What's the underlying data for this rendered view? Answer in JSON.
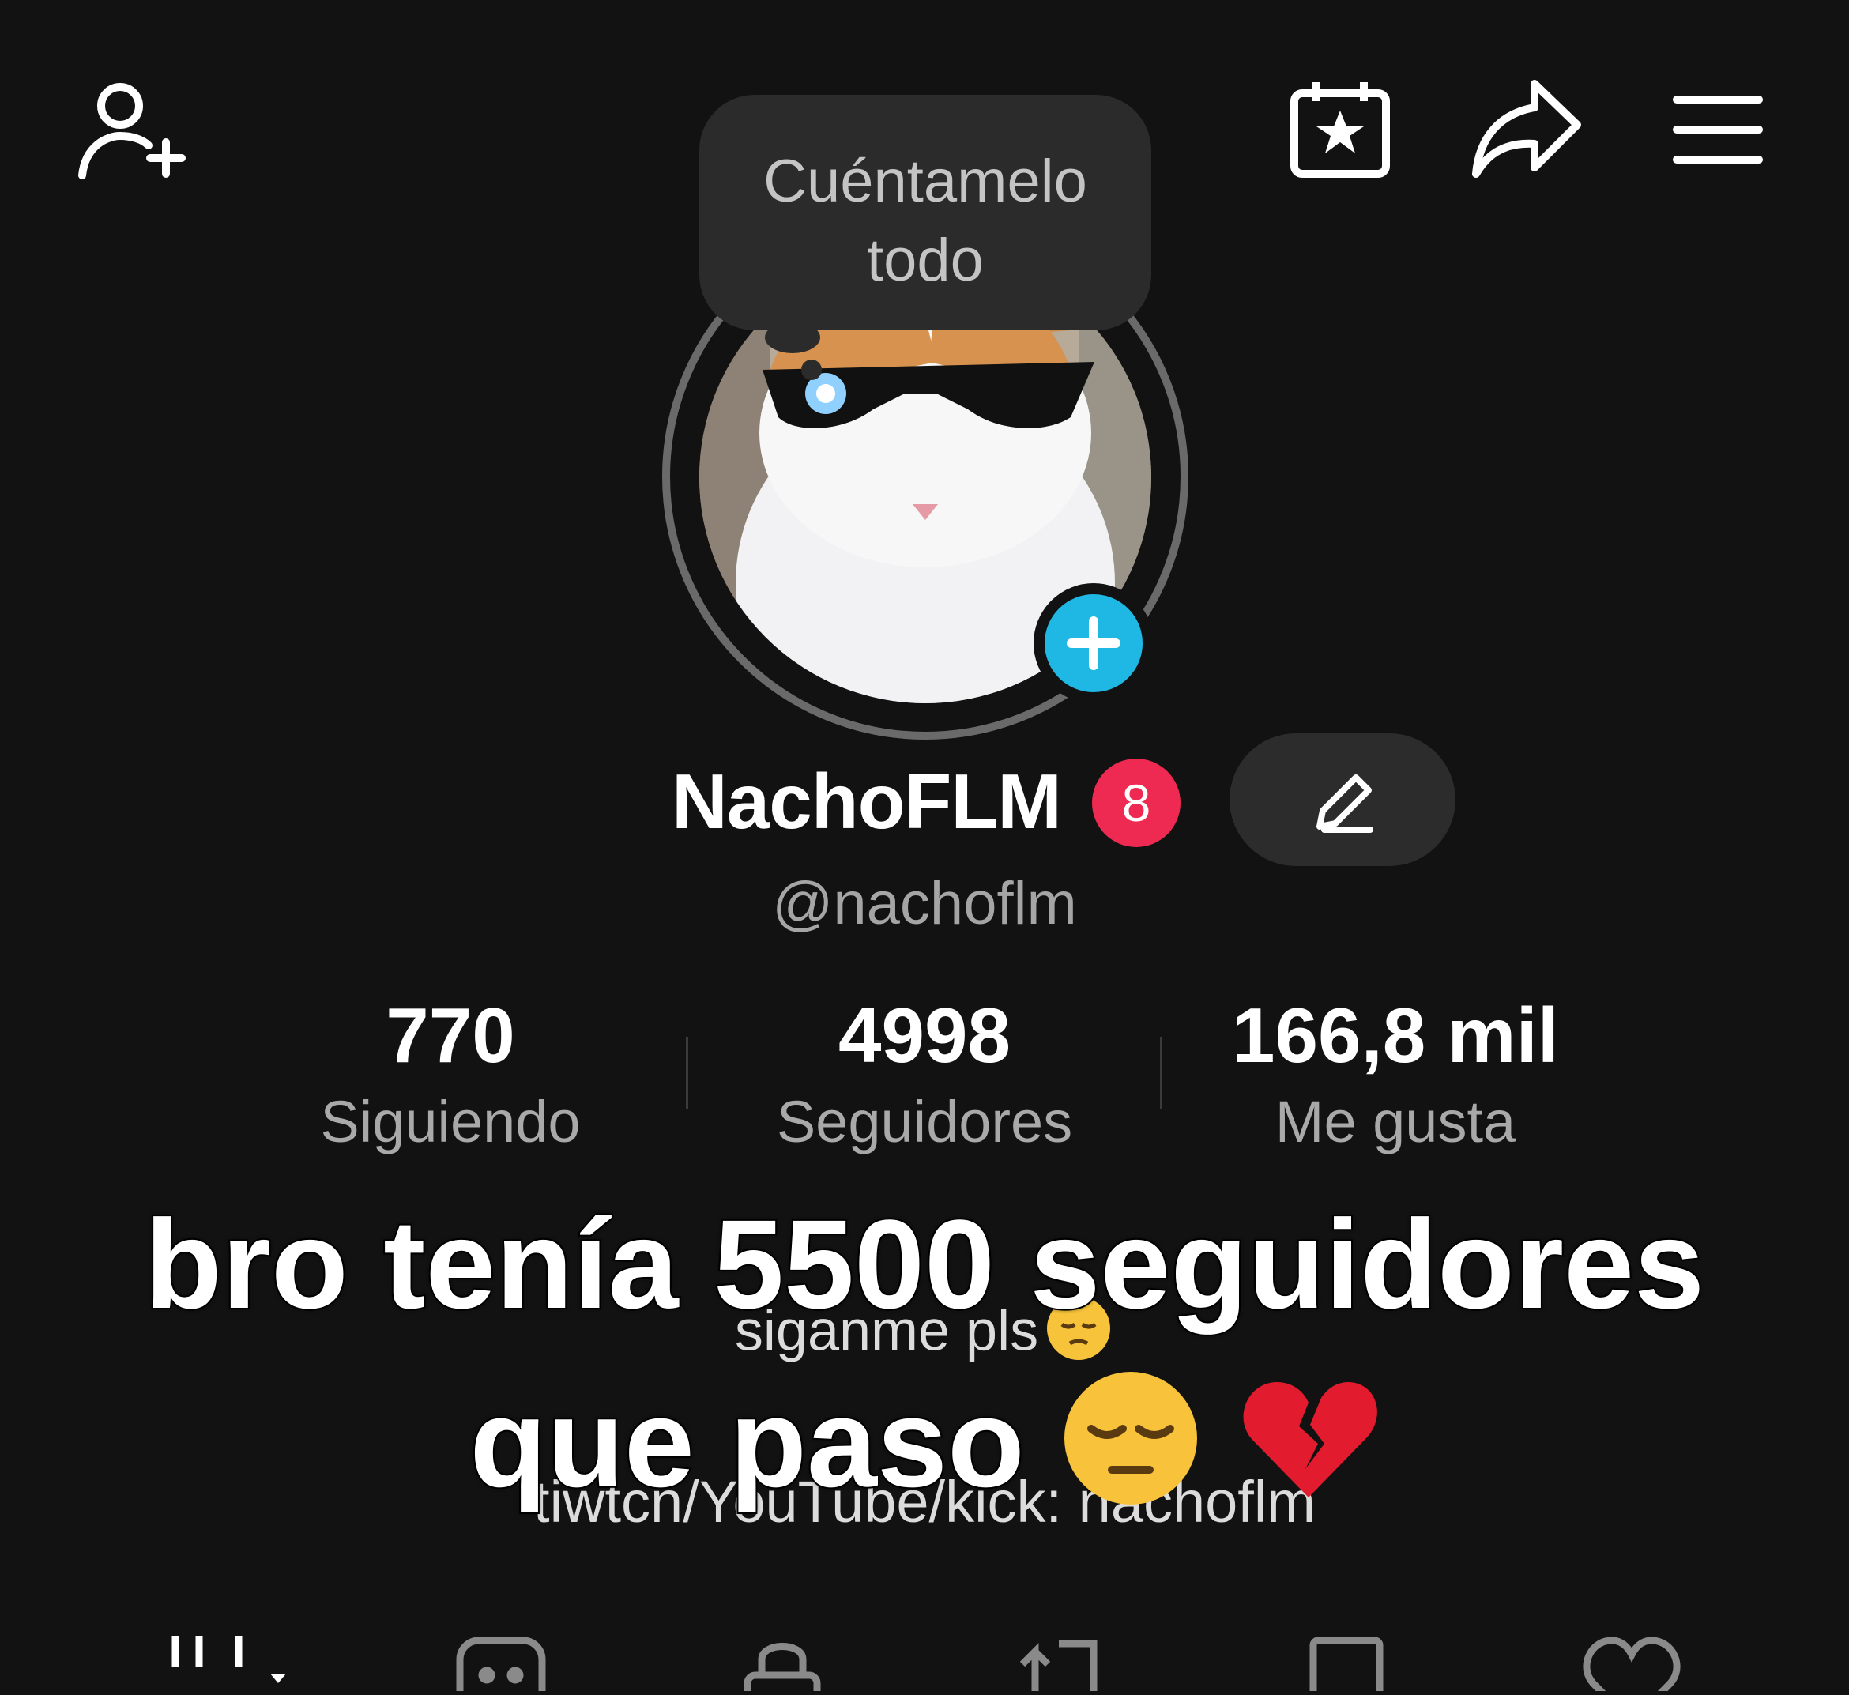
{
  "header": {
    "icons": [
      "add-friend-icon",
      "calendar-star-icon",
      "share-icon",
      "menu-icon"
    ]
  },
  "note": {
    "line1": "Cuéntamelo",
    "line2": "todo"
  },
  "profile": {
    "display_name": "NachoFLM",
    "badge_count": "8",
    "handle": "@nachoflm",
    "avatar": "cat-with-sunglasses-image"
  },
  "stats": [
    {
      "value": "770",
      "label": "Siguiendo"
    },
    {
      "value": "4998",
      "label": "Seguidores"
    },
    {
      "value": "166,8 mil",
      "label": "Me gusta"
    }
  ],
  "bio": {
    "line2": "siganme pls",
    "line4": "tiwtcn/YouTube/kick: nachoflm"
  },
  "overlay_caption": {
    "line1": "bro tenía 5500 seguidores",
    "line2": "que paso"
  },
  "colors": {
    "background": "#121212",
    "accent_blue": "#1fb8e5",
    "badge_red": "#ee2a52",
    "surface": "#2b2b2b"
  },
  "tabs": [
    "videos-grid-icon",
    "reposts-icon",
    "private-lock-icon",
    "shared-icon",
    "saved-icon",
    "liked-heart-icon"
  ]
}
